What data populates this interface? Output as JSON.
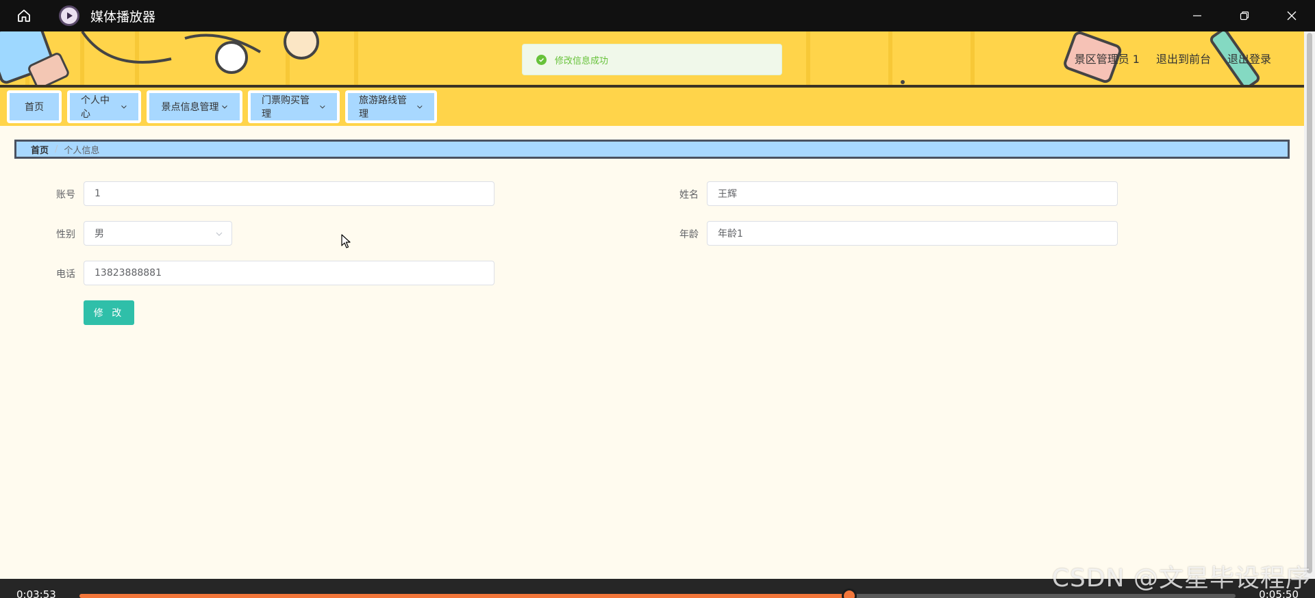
{
  "window": {
    "title": "媒体播放器",
    "home_icon": "home-icon",
    "app_icon": "play-icon",
    "controls": [
      "minimize-icon",
      "restore-icon",
      "close-icon"
    ]
  },
  "header": {
    "user_label": "景区管理员 1",
    "front_link": "退出到前台",
    "logout_link": "退出登录",
    "bg_color": "#ffd44a"
  },
  "toast": {
    "message": "修改信息成功",
    "icon": "success-check-icon",
    "color": "#67c23a"
  },
  "nav": {
    "items": [
      {
        "label": "首页",
        "has_dropdown": false
      },
      {
        "label": "个人中心",
        "has_dropdown": true
      },
      {
        "label": "景点信息管理",
        "has_dropdown": true
      },
      {
        "label": "门票购买管理",
        "has_dropdown": true
      },
      {
        "label": "旅游路线管理",
        "has_dropdown": true
      }
    ],
    "item_color": "#a8d8ff"
  },
  "breadcrumb": {
    "home": "首页",
    "separator": "/",
    "current": "个人信息"
  },
  "form": {
    "account": {
      "label": "账号",
      "value": "1"
    },
    "name": {
      "label": "姓名",
      "value": "王辉"
    },
    "gender": {
      "label": "性别",
      "value": "男"
    },
    "age": {
      "label": "年龄",
      "value": "年龄1"
    },
    "phone": {
      "label": "电话",
      "value": "13823888881"
    },
    "submit_label": "修 改",
    "submit_color": "#2fbfa9"
  },
  "player": {
    "current_time": "0:03:53",
    "total_time": "0:05:50",
    "progress_fraction": 0.666,
    "accent": "#f2763a"
  },
  "watermark": "CSDN @文星毕设程序"
}
